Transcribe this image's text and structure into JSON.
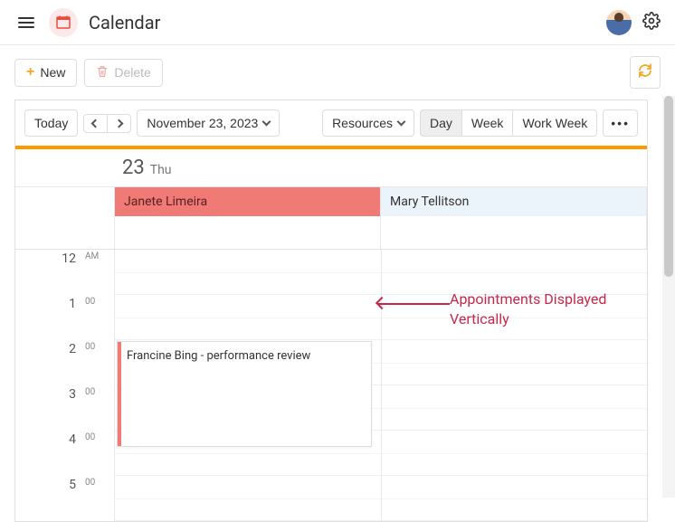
{
  "app": {
    "title": "Calendar"
  },
  "toolbar": {
    "new_label": "New",
    "delete_label": "Delete"
  },
  "scheduler": {
    "today_label": "Today",
    "date_label": "November 23, 2023",
    "resources_label": "Resources",
    "views": {
      "day": "Day",
      "week": "Week",
      "work_week": "Work Week"
    },
    "active_view": "Day",
    "date_header": {
      "num": "23",
      "day": "Thu"
    },
    "columns": [
      {
        "name": "Janete Limeira",
        "color": "#ef7a76"
      },
      {
        "name": "Mary Tellitson",
        "color": "#ecf4fb"
      }
    ],
    "hours": [
      {
        "num": "12",
        "suffix": "AM"
      },
      {
        "num": "1",
        "suffix": "00"
      },
      {
        "num": "2",
        "suffix": "00"
      },
      {
        "num": "3",
        "suffix": "00"
      },
      {
        "num": "4",
        "suffix": "00"
      },
      {
        "num": "5",
        "suffix": "00"
      }
    ],
    "appointment": {
      "title": "Francine Bing - performance review"
    }
  },
  "annotation": {
    "line1": "Appointments Displayed",
    "line2": "Vertically"
  }
}
